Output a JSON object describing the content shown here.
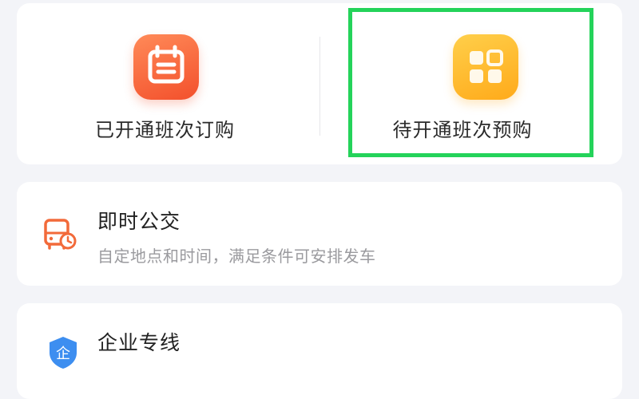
{
  "top_options": {
    "left_label": "已开通班次订购",
    "right_label": "待开通班次预购",
    "left_icon": "calendar-icon",
    "right_icon": "grid-apps-icon"
  },
  "services": [
    {
      "title": "即时公交",
      "description": "自定地点和时间，满足条件可安排发车",
      "icon": "bus-clock-icon"
    },
    {
      "title": "企业专线",
      "icon": "company-shield-icon",
      "icon_text": "企"
    }
  ],
  "colors": {
    "background": "#f3f4f8",
    "highlight": "#24d35a",
    "orange": "#f3502c",
    "yellow": "#ffaa1a",
    "blue": "#3d8ef0"
  }
}
